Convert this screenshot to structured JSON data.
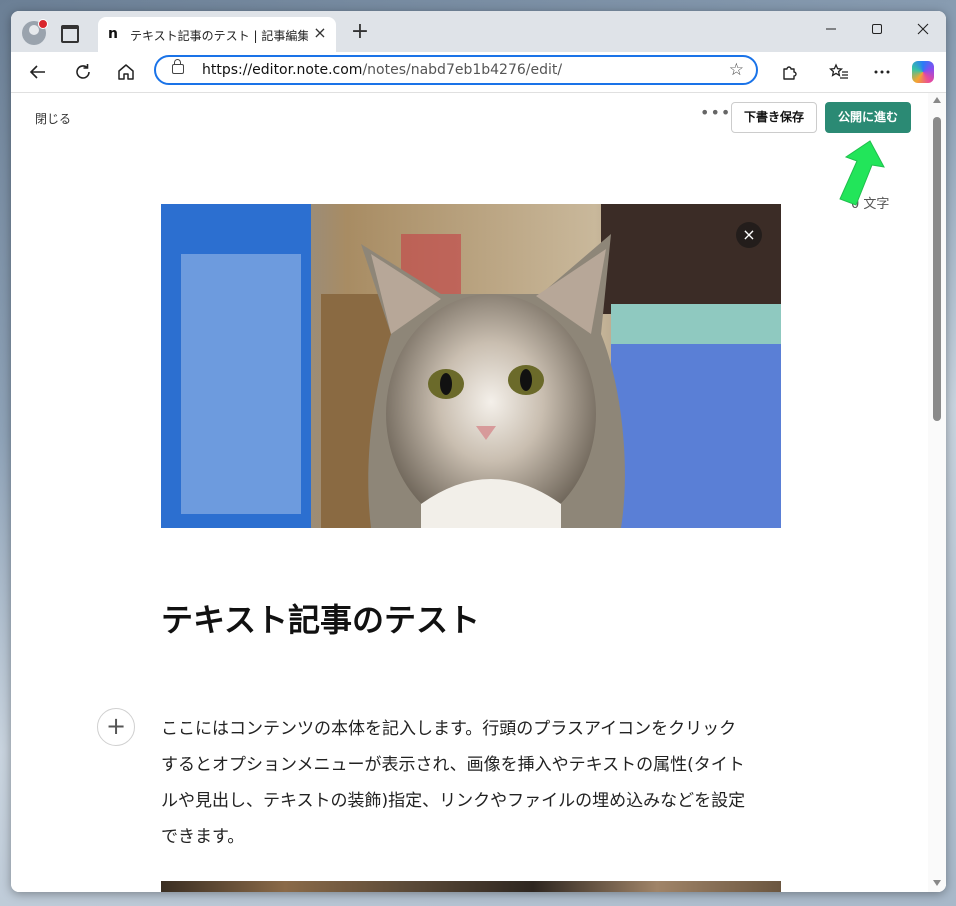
{
  "browser": {
    "tab_title": "テキスト記事のテスト | 記事編集 | note",
    "tab_favicon": "n",
    "new_tab_label": "+",
    "url_host": "https://editor.note.com",
    "url_path": "/notes/nabd7eb1b4276/edit/",
    "window_controls": [
      "minimize-icon",
      "maximize-icon",
      "close-icon"
    ]
  },
  "editor": {
    "close_label": "閉じる",
    "more_label": "•••",
    "draft_label": "下書き保存",
    "publish_label": "公開に進む",
    "char_count_label": "0 文字",
    "title": "テキスト記事のテスト",
    "body_lines": [
      "ここにはコンテンツの本体を記入します。行頭のプラスアイコンをクリック",
      "するとオプションメニューが表示され、画像を挿入やテキストの属性(タイト",
      "ルや見出し、テキストの装飾)指定、リンクやファイルの埋め込みなどを設定",
      "できます。"
    ],
    "insert_label": "+",
    "image_remove_label": "×"
  },
  "colors": {
    "accent": "#2b8a74",
    "address_border": "#1a73e8",
    "annotation_arrow": "#22e55a"
  },
  "icons": {
    "back": "arrow-left-icon",
    "reload": "reload-icon",
    "home": "home-icon",
    "lock": "lock-icon",
    "favorite": "star-icon",
    "extensions": "puzzle-icon",
    "favorites": "favorites-icon",
    "menu": "more-icon",
    "copilot": "copilot-icon"
  }
}
